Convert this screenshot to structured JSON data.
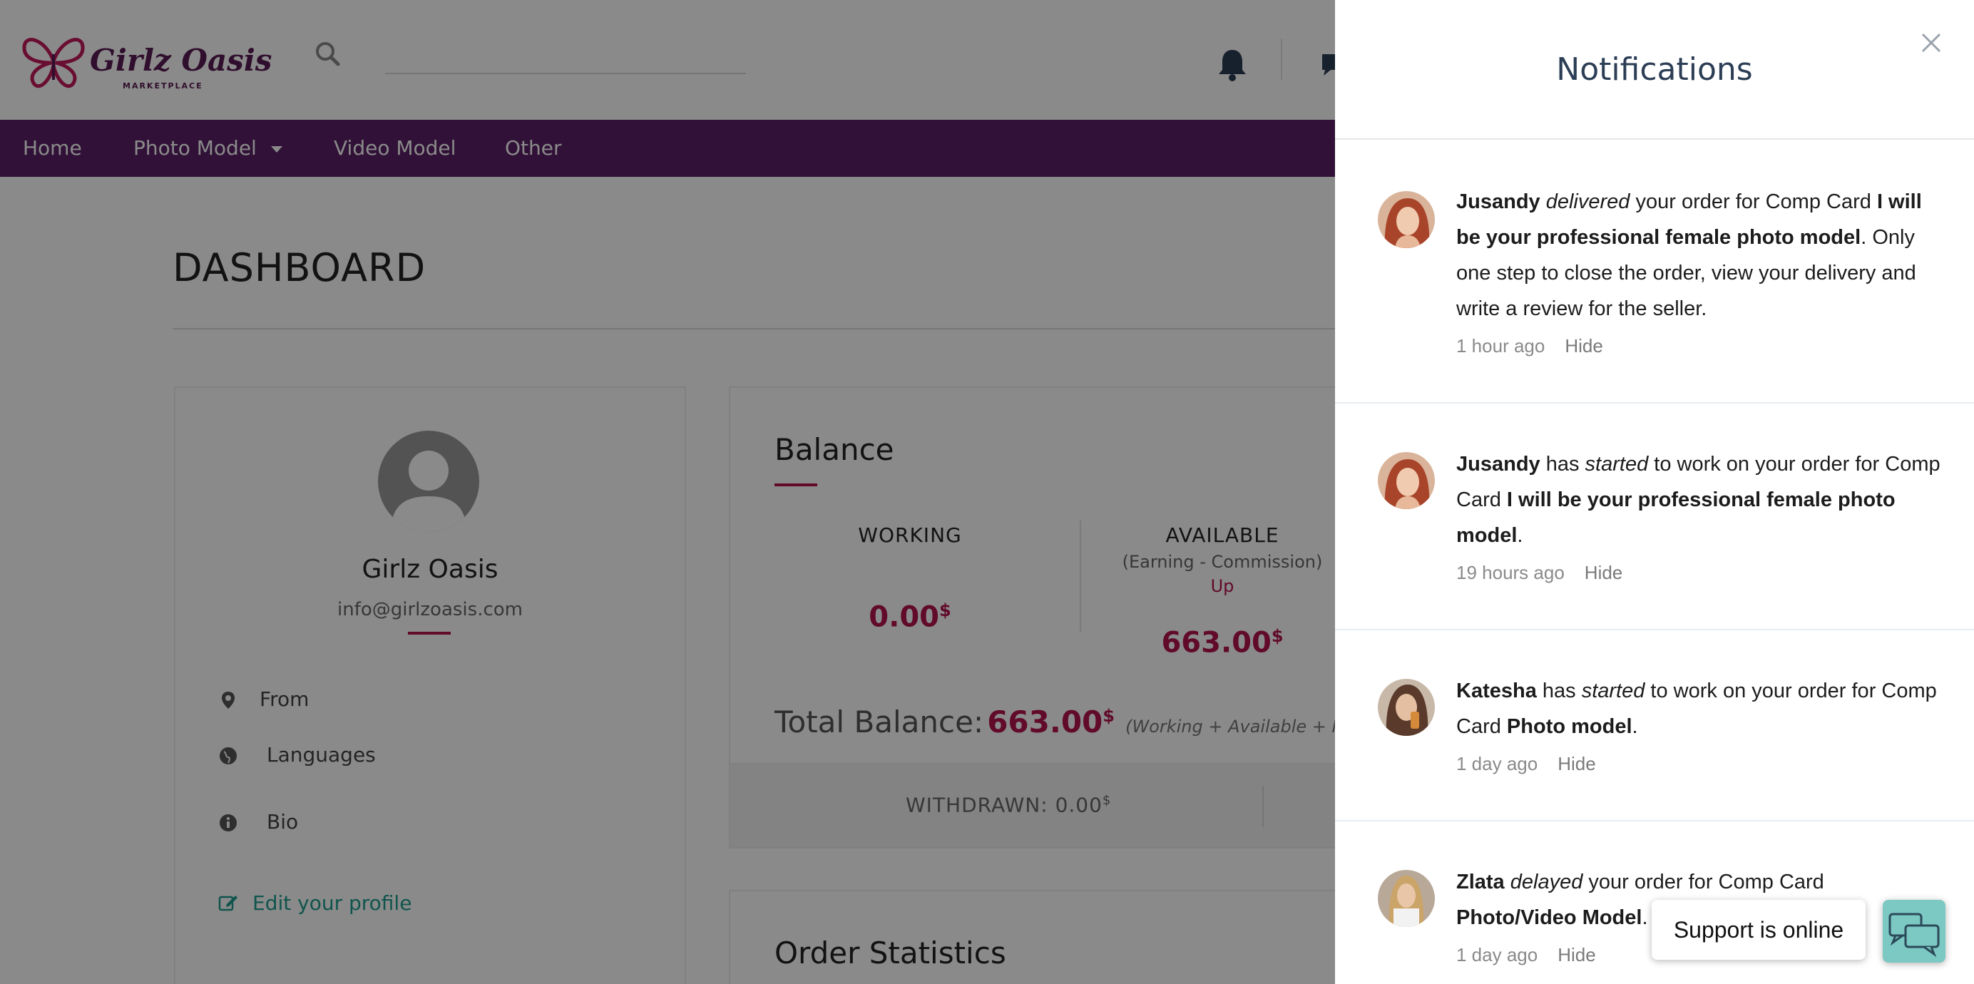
{
  "brand": {
    "logo_text": "Girlz Oasis",
    "logo_sub": "MARKETPLACE",
    "accent": "#b3134e",
    "nav_bg": "#5b2067"
  },
  "search": {
    "placeholder": ""
  },
  "nav": {
    "items": [
      {
        "label": "Home"
      },
      {
        "label": "Photo Model"
      },
      {
        "label": "Video Model"
      },
      {
        "label": "Other"
      }
    ]
  },
  "dashboard": {
    "title": "DASHBOARD"
  },
  "profile": {
    "name": "Girlz Oasis",
    "email": "info@girlzoasis.com",
    "from_label": "From",
    "languages_label": "Languages",
    "bio_label": "Bio",
    "edit_label": "Edit your profile"
  },
  "balance": {
    "title": "Balance",
    "working_label": "WORKING",
    "working_value": "0.00",
    "available_label": "AVAILABLE",
    "available_sub": "(Earning - Commission)",
    "available_up": "Up",
    "available_value": "663.00",
    "currency": "$",
    "total_label": "Total Balance:",
    "total_value": "663.00",
    "total_note": "(Working + Available + Pendin",
    "withdrawn_label": "WITHDRAWN: 0.00"
  },
  "order_stats": {
    "title": "Order Statistics"
  },
  "notifications": {
    "title": "Notifications",
    "hide_label": "Hide",
    "items": [
      {
        "name": "Jusandy",
        "action": "delivered",
        "text1": " your order for Comp Card ",
        "bold": "I will be your professional female photo model",
        "text2": ". Only one step to close the order, view your delivery and write a review for the seller.",
        "time": "1 hour ago"
      },
      {
        "name": "Jusandy",
        "pre": " has ",
        "action": "started",
        "text1": " to work on your order for Comp Card ",
        "bold": "I will be your professional female photo model",
        "text2": ".",
        "time": "19 hours ago"
      },
      {
        "name": "Katesha",
        "pre": " has ",
        "action": "started",
        "text1": " to work on your order for Comp Card ",
        "bold": "Photo model",
        "text2": ".",
        "time": "1 day ago"
      },
      {
        "name": "Zlata",
        "action": "delayed",
        "text1": " your order for Comp Card ",
        "bold": "Photo/Video Model",
        "text2": ".",
        "time": "1 day ago"
      }
    ]
  },
  "support": {
    "label": "Support is online"
  }
}
